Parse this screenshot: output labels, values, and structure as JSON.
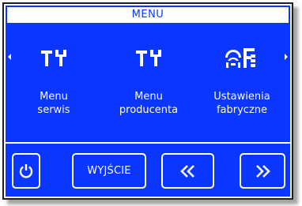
{
  "header": {
    "title": "MENU"
  },
  "items": [
    {
      "label_line1": "Menu",
      "label_line2": "serwis",
      "icon": "tools-icon"
    },
    {
      "label_line1": "Menu",
      "label_line2": "producenta",
      "icon": "tools-icon"
    },
    {
      "label_line1": "Ustawienia",
      "label_line2": "fabryczne",
      "icon": "factory-settings-icon"
    }
  ],
  "buttons": {
    "power_icon": "power-icon",
    "exit_label": "WYJŚCIE",
    "prev_label": "<<",
    "next_label": ">>"
  },
  "colors": {
    "screen": "#0b36ff",
    "foreground": "#ffffff"
  }
}
